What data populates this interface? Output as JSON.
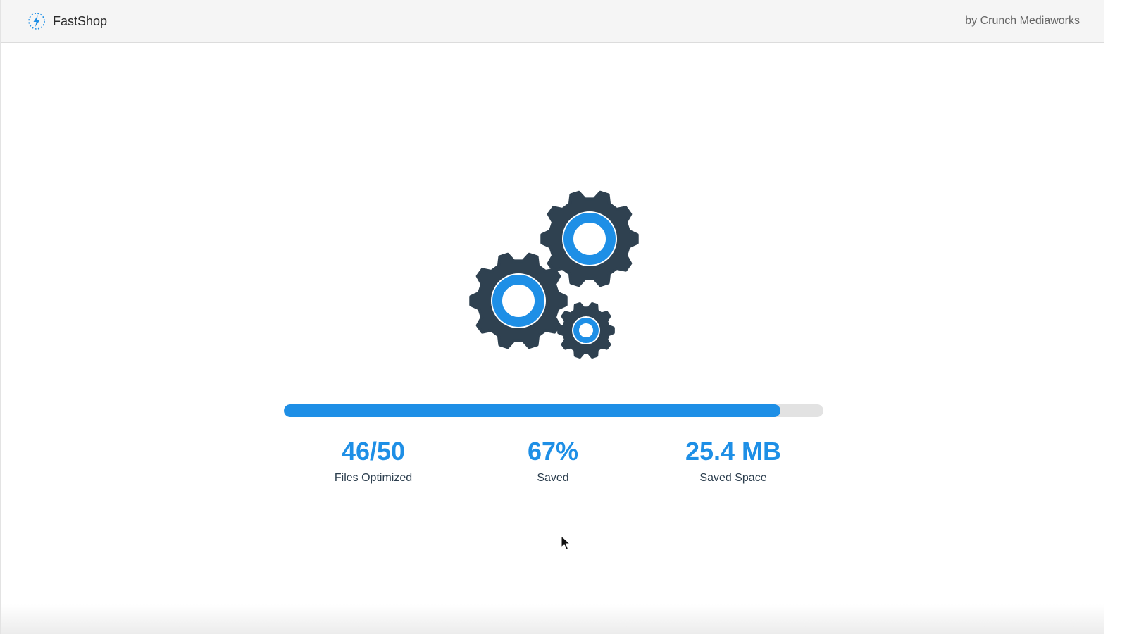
{
  "header": {
    "app_title": "FastShop",
    "byline": "by Crunch Mediaworks",
    "logo_icon": "lightning-bolt-icon"
  },
  "illustration": {
    "icon": "gears-icon",
    "colors": {
      "gear": "#2f4150",
      "ring": "#1e8fe6"
    }
  },
  "progress": {
    "value": 0.92,
    "fill_color": "#1e8fe6",
    "track_color": "#e2e2e2"
  },
  "stats": [
    {
      "value": "46/50",
      "label": "Files Optimized"
    },
    {
      "value": "67%",
      "label": "Saved"
    },
    {
      "value": "25.4 MB",
      "label": "Saved Space"
    }
  ]
}
